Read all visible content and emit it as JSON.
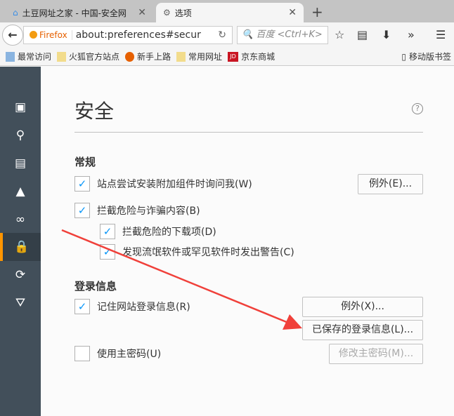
{
  "tabs": [
    {
      "title": "土豆网址之家 - 中国-安全网",
      "icon": "home-icon"
    },
    {
      "title": "选项",
      "icon": "gear-icon"
    }
  ],
  "nav": {
    "brand": "Firefox",
    "url": "about:preferences#secur",
    "search_placeholder": "百度 <Ctrl+K>"
  },
  "bookmarks": [
    "最常访问",
    "火狐官方站点",
    "新手上路",
    "常用网址",
    "京东商城"
  ],
  "mobile_bookmarks": "移动版书签",
  "jd_logo": "JD",
  "page": {
    "title": "安全",
    "help": "?",
    "general": {
      "heading": "常规",
      "items": [
        "站点尝试安装附加组件时询问我(W)",
        "拦截危险与诈骗内容(B)",
        "拦截危险的下载项(D)",
        "发现流氓软件或罕见软件时发出警告(C)"
      ],
      "exceptions": "例外(E)..."
    },
    "login": {
      "heading": "登录信息",
      "remember": "记住网站登录信息(R)",
      "exceptions": "例外(X)...",
      "saved": "已保存的登录信息(L)...",
      "master": "使用主密码(U)",
      "change_master": "修改主密码(M)..."
    }
  },
  "colors": {
    "accent": "#0996f8",
    "sidebar": "#424f5a",
    "active": "#ff9500",
    "arrow": "#f0403a"
  }
}
